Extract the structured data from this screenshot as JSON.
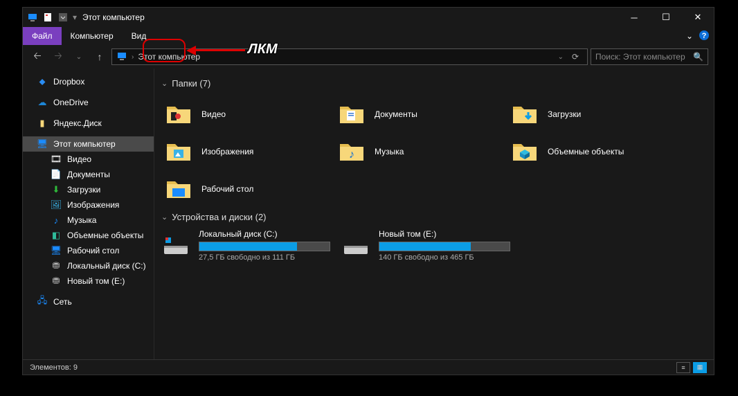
{
  "annotation": {
    "label": "ЛКМ"
  },
  "titlebar": {
    "title": "Этот компьютер"
  },
  "ribbon": {
    "file": "Файл",
    "computer": "Компьютер",
    "view": "Вид"
  },
  "nav": {
    "breadcrumb": "Этот компьютер",
    "search_placeholder": "Поиск: Этот компьютер"
  },
  "sidebar": {
    "dropbox": "Dropbox",
    "onedrive": "OneDrive",
    "yandexdisk": "Яндекс.Диск",
    "thispc": "Этот компьютер",
    "videos": "Видео",
    "documents": "Документы",
    "downloads": "Загрузки",
    "pictures": "Изображения",
    "music": "Музыка",
    "objects3d": "Объемные объекты",
    "desktop": "Рабочий стол",
    "diskC": "Локальный диск (C:)",
    "diskE": "Новый том (E:)",
    "network": "Сеть"
  },
  "content": {
    "folders_header": "Папки (7)",
    "drives_header": "Устройства и диски (2)",
    "folders": {
      "videos": "Видео",
      "documents": "Документы",
      "downloads": "Загрузки",
      "pictures": "Изображения",
      "music": "Музыка",
      "objects3d": "Объемные объекты",
      "desktop": "Рабочий стол"
    },
    "drives": {
      "c": {
        "name": "Локальный диск (C:)",
        "text": "27,5 ГБ свободно из 111 ГБ",
        "fill_pct": 75
      },
      "e": {
        "name": "Новый том (E:)",
        "text": "140 ГБ свободно из 465 ГБ",
        "fill_pct": 70
      }
    }
  },
  "statusbar": {
    "items": "Элементов: 9"
  }
}
